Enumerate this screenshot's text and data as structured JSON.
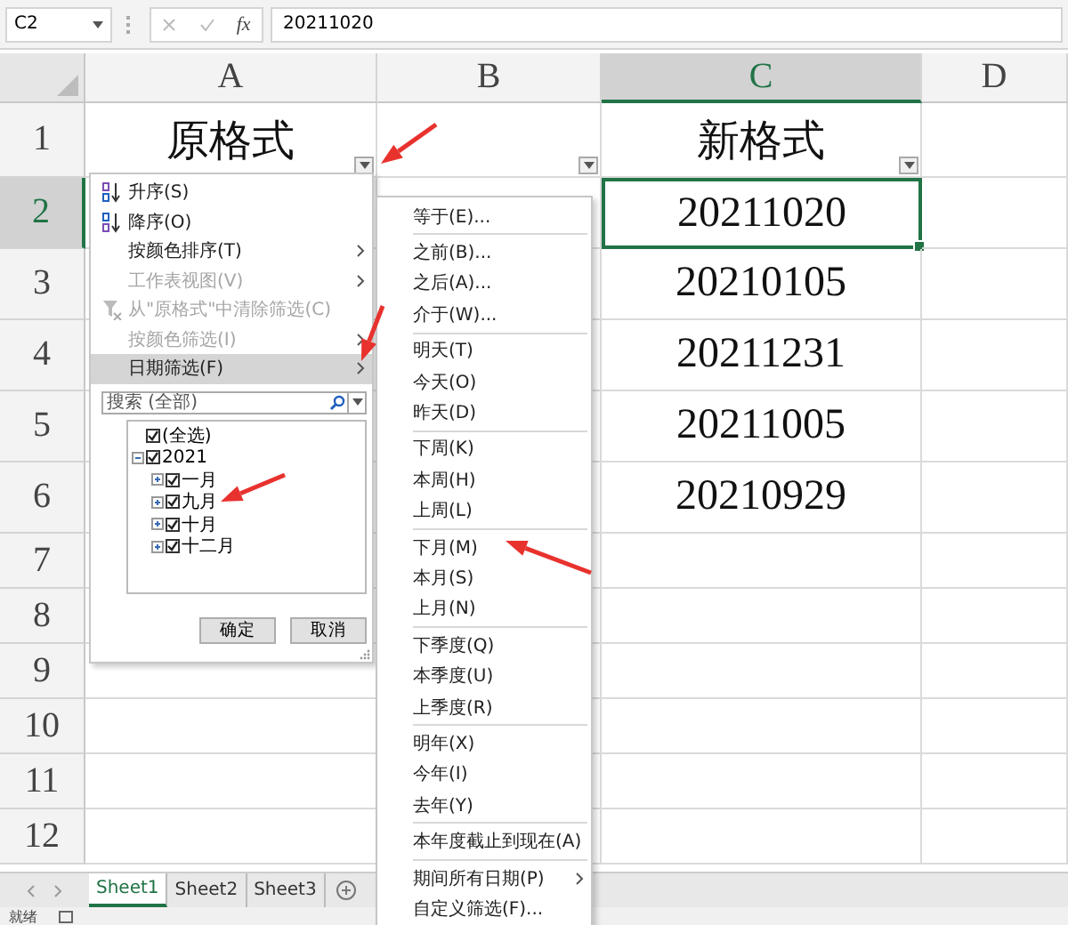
{
  "formula_bar": {
    "name_box": "C2",
    "function_label": "fx",
    "value": "20211020"
  },
  "columns": [
    {
      "label": "A",
      "selected": false
    },
    {
      "label": "B",
      "selected": false
    },
    {
      "label": "C",
      "selected": true
    },
    {
      "label": "D",
      "selected": false
    }
  ],
  "rows": [
    {
      "label": "1",
      "selected": false,
      "cells": [
        {
          "text": "原格式",
          "filter": true,
          "selected": false
        },
        {
          "filter": true,
          "selected": false
        },
        {
          "text": "新格式",
          "filter": true,
          "selected": false
        },
        {
          "filter": false,
          "selected": false
        }
      ]
    },
    {
      "label": "2",
      "selected": true,
      "cells": [
        {
          "filter": false,
          "selected": false
        },
        {
          "filter": false,
          "selected": false
        },
        {
          "text": "20211020",
          "filter": false,
          "selected": true
        },
        {
          "filter": false,
          "selected": false
        }
      ]
    },
    {
      "label": "3",
      "selected": false,
      "cells": [
        {
          "filter": false,
          "selected": false
        },
        {
          "filter": false,
          "selected": false
        },
        {
          "text": "20210105",
          "filter": false,
          "selected": false
        },
        {
          "filter": false,
          "selected": false
        }
      ]
    },
    {
      "label": "4",
      "selected": false,
      "cells": [
        {
          "filter": false,
          "selected": false
        },
        {
          "filter": false,
          "selected": false
        },
        {
          "text": "20211231",
          "filter": false,
          "selected": false
        },
        {
          "filter": false,
          "selected": false
        }
      ]
    },
    {
      "label": "5",
      "selected": false,
      "cells": [
        {
          "filter": false,
          "selected": false
        },
        {
          "filter": false,
          "selected": false
        },
        {
          "text": "20211005",
          "filter": false,
          "selected": false
        },
        {
          "filter": false,
          "selected": false
        }
      ]
    },
    {
      "label": "6",
      "selected": false,
      "cells": [
        {
          "filter": false,
          "selected": false
        },
        {
          "filter": false,
          "selected": false
        },
        {
          "text": "20210929",
          "filter": false,
          "selected": false
        },
        {
          "filter": false,
          "selected": false
        }
      ]
    },
    {
      "label": "7",
      "selected": false
    },
    {
      "label": "8",
      "selected": false
    },
    {
      "label": "9",
      "selected": false
    },
    {
      "label": "10",
      "selected": false
    },
    {
      "label": "11",
      "selected": false
    },
    {
      "label": "12",
      "selected": false
    }
  ],
  "filter_menu": {
    "items": [
      {
        "kind": "sort_ascending",
        "label": "升序(S)",
        "disabled": false,
        "highlighted": false,
        "submenu": false
      },
      {
        "kind": "sort_descending",
        "label": "降序(O)",
        "disabled": false,
        "highlighted": false,
        "submenu": false
      },
      {
        "kind": "item",
        "label": "按颜色排序(T)",
        "disabled": false,
        "highlighted": false,
        "submenu": true
      },
      {
        "kind": "item",
        "label": "工作表视图(V)",
        "disabled": true,
        "highlighted": false,
        "submenu": true
      },
      {
        "kind": "clear_filter",
        "label": "从\"原格式\"中清除筛选(C)",
        "disabled": true,
        "highlighted": false,
        "submenu": false
      },
      {
        "kind": "item",
        "label": "按颜色筛选(I)",
        "disabled": true,
        "highlighted": false,
        "submenu": true
      },
      {
        "kind": "item",
        "label": "日期筛选(F)",
        "disabled": false,
        "highlighted": true,
        "submenu": true
      }
    ],
    "search": {
      "placeholder": "搜索 (全部)"
    },
    "tree": [
      {
        "label": "(全选)",
        "checked": true
      },
      {
        "label": "2021",
        "checked": true,
        "expanded": true,
        "children": [
          {
            "label": "一月",
            "checked": true,
            "expanded": false
          },
          {
            "label": "九月",
            "checked": true,
            "expanded": false
          },
          {
            "label": "十月",
            "checked": true,
            "expanded": false
          },
          {
            "label": "十二月",
            "checked": true,
            "expanded": false
          }
        ]
      }
    ],
    "buttons": [
      "确定",
      "取消"
    ]
  },
  "date_submenu": {
    "groups": [
      {
        "items": [
          {
            "label": "等于(E)...",
            "submenu": false
          }
        ]
      },
      {
        "items": [
          {
            "label": "之前(B)...",
            "submenu": false
          },
          {
            "label": "之后(A)...",
            "submenu": false
          },
          {
            "label": "介于(W)...",
            "submenu": false
          }
        ]
      },
      {
        "items": [
          {
            "label": "明天(T)",
            "submenu": false
          },
          {
            "label": "今天(O)",
            "submenu": false
          },
          {
            "label": "昨天(D)",
            "submenu": false
          }
        ]
      },
      {
        "items": [
          {
            "label": "下周(K)",
            "submenu": false
          },
          {
            "label": "本周(H)",
            "submenu": false
          },
          {
            "label": "上周(L)",
            "submenu": false
          }
        ]
      },
      {
        "items": [
          {
            "label": "下月(M)",
            "submenu": false
          },
          {
            "label": "本月(S)",
            "submenu": false
          },
          {
            "label": "上月(N)",
            "submenu": false
          }
        ]
      },
      {
        "items": [
          {
            "label": "下季度(Q)",
            "submenu": false
          },
          {
            "label": "本季度(U)",
            "submenu": false
          },
          {
            "label": "上季度(R)",
            "submenu": false
          }
        ]
      },
      {
        "items": [
          {
            "label": "明年(X)",
            "submenu": false
          },
          {
            "label": "今年(I)",
            "submenu": false
          },
          {
            "label": "去年(Y)",
            "submenu": false
          }
        ]
      },
      {
        "items": [
          {
            "label": "本年度截止到现在(A)",
            "submenu": false
          }
        ]
      },
      {
        "items": [
          {
            "label": "期间所有日期(P)",
            "submenu": true
          },
          {
            "label": "自定义筛选(F)...",
            "submenu": false
          }
        ]
      }
    ]
  },
  "sheet_tabs": [
    {
      "label": "Sheet1",
      "selected": true
    },
    {
      "label": "Sheet2",
      "selected": false
    },
    {
      "label": "Sheet3",
      "selected": false
    }
  ],
  "status_bar": {
    "text": "就绪"
  }
}
